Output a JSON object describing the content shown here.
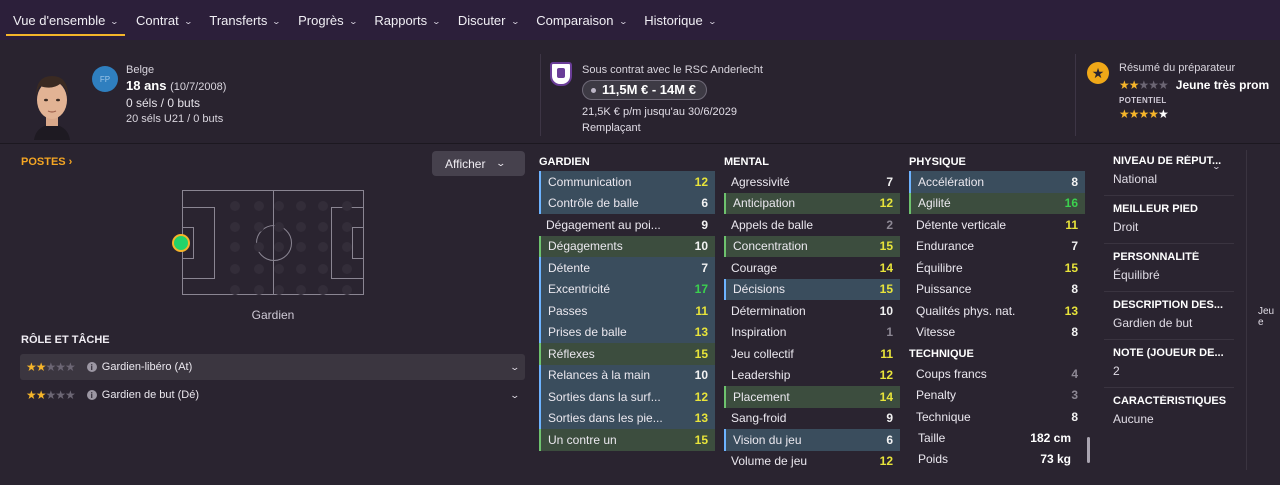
{
  "nav": {
    "items": [
      {
        "label": "Vue d'ensemble",
        "active": true
      },
      {
        "label": "Contrat"
      },
      {
        "label": "Transferts"
      },
      {
        "label": "Progrès"
      },
      {
        "label": "Rapports"
      },
      {
        "label": "Discuter"
      },
      {
        "label": "Comparaison"
      },
      {
        "label": "Historique"
      }
    ]
  },
  "player": {
    "position_badge": "FP",
    "nationality": "Belge",
    "age": "18 ans",
    "dob": "(10/7/2008)",
    "caps": "0 séls / 0 buts",
    "u21": "20 séls U21 / 0 buts"
  },
  "contract": {
    "club_line": "Sous contrat avec le RSC Anderlecht",
    "value": "11,5M € - 14M €",
    "wage": "21,5K € p/m jusqu'au 30/6/2029",
    "status": "Remplaçant"
  },
  "coach": {
    "title": "Résumé du préparateur",
    "summary": "Jeune très prom",
    "potential_label": "POTENTIEL",
    "ability_stars": 2,
    "potential_stars": 4
  },
  "left": {
    "postes_label": "POSTES ›",
    "afficher_label": "Afficher",
    "pitch_label": "Gardien",
    "roles_title": "RÔLE ET TÂCHE",
    "roles": [
      {
        "label": "Gardien-libéro (At)",
        "stars": 2
      },
      {
        "label": "Gardien de but (Dé)",
        "stars": 2
      }
    ]
  },
  "attributes": {
    "goalkeeper": {
      "title": "GARDIEN",
      "items": [
        {
          "name": "Communication",
          "value": "12",
          "color": "yellow",
          "key": "blue"
        },
        {
          "name": "Contrôle de balle",
          "value": "6",
          "color": "white",
          "key": "blue"
        },
        {
          "name": "Dégagement au poi...",
          "value": "9",
          "color": "white",
          "key": ""
        },
        {
          "name": "Dégagements",
          "value": "10",
          "color": "white",
          "key": "green"
        },
        {
          "name": "Détente",
          "value": "7",
          "color": "white",
          "key": "blue"
        },
        {
          "name": "Excentricité",
          "value": "17",
          "color": "green",
          "key": "blue"
        },
        {
          "name": "Passes",
          "value": "11",
          "color": "yellow",
          "key": "blue"
        },
        {
          "name": "Prises de balle",
          "value": "13",
          "color": "yellow",
          "key": "blue"
        },
        {
          "name": "Réflexes",
          "value": "15",
          "color": "yellow",
          "key": "green"
        },
        {
          "name": "Relances à la main",
          "value": "10",
          "color": "white",
          "key": "blue"
        },
        {
          "name": "Sorties dans la surf...",
          "value": "12",
          "color": "yellow",
          "key": "blue"
        },
        {
          "name": "Sorties dans les pie...",
          "value": "13",
          "color": "yellow",
          "key": "blue"
        },
        {
          "name": "Un contre un",
          "value": "15",
          "color": "yellow",
          "key": "green"
        }
      ]
    },
    "mental": {
      "title": "MENTAL",
      "items": [
        {
          "name": "Agressivité",
          "value": "7",
          "color": "white",
          "key": ""
        },
        {
          "name": "Anticipation",
          "value": "12",
          "color": "yellow",
          "key": "green"
        },
        {
          "name": "Appels de balle",
          "value": "2",
          "color": "grey",
          "key": ""
        },
        {
          "name": "Concentration",
          "value": "15",
          "color": "yellow",
          "key": "green"
        },
        {
          "name": "Courage",
          "value": "14",
          "color": "yellow",
          "key": ""
        },
        {
          "name": "Décisions",
          "value": "15",
          "color": "yellow",
          "key": "blue"
        },
        {
          "name": "Détermination",
          "value": "10",
          "color": "white",
          "key": ""
        },
        {
          "name": "Inspiration",
          "value": "1",
          "color": "grey",
          "key": ""
        },
        {
          "name": "Jeu collectif",
          "value": "11",
          "color": "yellow",
          "key": ""
        },
        {
          "name": "Leadership",
          "value": "12",
          "color": "yellow",
          "key": ""
        },
        {
          "name": "Placement",
          "value": "14",
          "color": "yellow",
          "key": "green"
        },
        {
          "name": "Sang-froid",
          "value": "9",
          "color": "white",
          "key": ""
        },
        {
          "name": "Vision du jeu",
          "value": "6",
          "color": "white",
          "key": "blue"
        },
        {
          "name": "Volume de jeu",
          "value": "12",
          "color": "yellow",
          "key": ""
        }
      ]
    },
    "physical": {
      "title": "PHYSIQUE",
      "items": [
        {
          "name": "Accélération",
          "value": "8",
          "color": "white",
          "key": "blue"
        },
        {
          "name": "Agilité",
          "value": "16",
          "color": "green",
          "key": "green"
        },
        {
          "name": "Détente verticale",
          "value": "11",
          "color": "yellow",
          "key": ""
        },
        {
          "name": "Endurance",
          "value": "7",
          "color": "white",
          "key": ""
        },
        {
          "name": "Équilibre",
          "value": "15",
          "color": "yellow",
          "key": ""
        },
        {
          "name": "Puissance",
          "value": "8",
          "color": "white",
          "key": ""
        },
        {
          "name": "Qualités phys. nat.",
          "value": "13",
          "color": "yellow",
          "key": ""
        },
        {
          "name": "Vitesse",
          "value": "8",
          "color": "white",
          "key": ""
        }
      ]
    },
    "technical": {
      "title": "TECHNIQUE",
      "items": [
        {
          "name": "Coups francs",
          "value": "4",
          "color": "grey",
          "key": ""
        },
        {
          "name": "Penalty",
          "value": "3",
          "color": "grey",
          "key": ""
        },
        {
          "name": "Technique",
          "value": "8",
          "color": "white",
          "key": ""
        }
      ]
    },
    "height_label": "Taille",
    "height": "182 cm",
    "weight_label": "Poids",
    "weight": "73 kg"
  },
  "info": {
    "reputation_label": "NIVEAU DE RÉPUT...",
    "reputation": "National",
    "foot_label": "MEILLEUR PIED",
    "foot": "Droit",
    "personality_label": "PERSONNALITÉ",
    "personality": "Équilibré",
    "description_label": "DESCRIPTION DES...",
    "description": "Gardien de but",
    "rating_label": "NOTE (JOUEUR DE...",
    "rating": "2",
    "traits_label": "CARACTÉRISTIQUES",
    "traits": "Aucune",
    "cut_text": "Jeu e"
  },
  "colors": {
    "accent": "#f5b52a",
    "key_blue": "#3a4d5d",
    "key_green": "#3c4d3e",
    "value_yellow": "#e8e43a",
    "value_green": "#3bd14e"
  }
}
